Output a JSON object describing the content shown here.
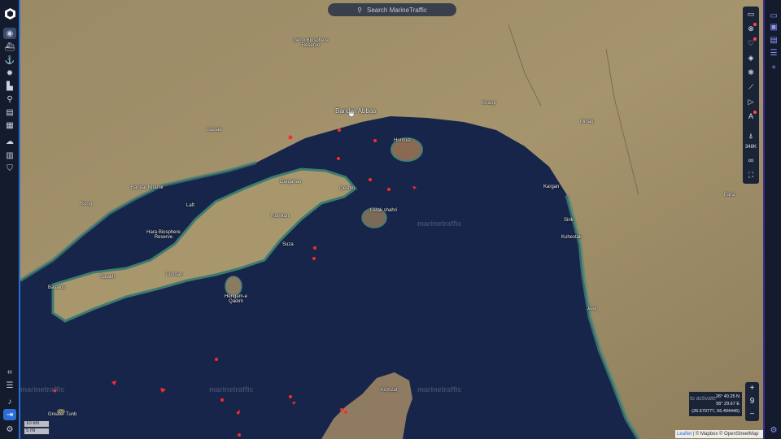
{
  "search": {
    "placeholder": "Search MarineTraffic"
  },
  "watermark": "marinetraffic",
  "scale": {
    "metric": "10 km",
    "imperial": "5 mi"
  },
  "coords": {
    "lat": "26° 40.25 N",
    "lon": "56° 29.67 E",
    "decimal": "(26.670777, 56.494446)"
  },
  "activate_text": "to activate",
  "attribution": {
    "leaflet": "Leaflet",
    "rest": " | © Mapbox © OpenStreetMap"
  },
  "toolbar": {
    "vessel_count": "348K"
  },
  "zoom": {
    "level": "9",
    "plus": "+",
    "minus": "−"
  },
  "places": [
    {
      "name": "Bandar Abbas",
      "big": true
    },
    {
      "name": "Hormuz"
    },
    {
      "name": "Larak shahri"
    },
    {
      "name": "Qeshm"
    },
    {
      "name": "Dargahan"
    },
    {
      "name": "Ramkan"
    },
    {
      "name": "Suza"
    },
    {
      "name": "Bandar Khamir"
    },
    {
      "name": "Kong"
    },
    {
      "name": "Laft"
    },
    {
      "name": "Hara Biosphere Reserve"
    },
    {
      "name": "Salakh"
    },
    {
      "name": "Basaidu"
    },
    {
      "name": "Tomban"
    },
    {
      "name": "Hengam-e Qadim"
    },
    {
      "name": "Greater Tunb"
    },
    {
      "name": "Kumzar"
    },
    {
      "name": "Minab"
    },
    {
      "name": "Kuhestak"
    },
    {
      "name": "Jask"
    },
    {
      "name": "Sirik"
    },
    {
      "name": "Kargan"
    },
    {
      "name": "Khargi"
    },
    {
      "name": "Geno Biosphere Reserve"
    },
    {
      "name": "Bastak"
    },
    {
      "name": "Pariz"
    }
  ]
}
